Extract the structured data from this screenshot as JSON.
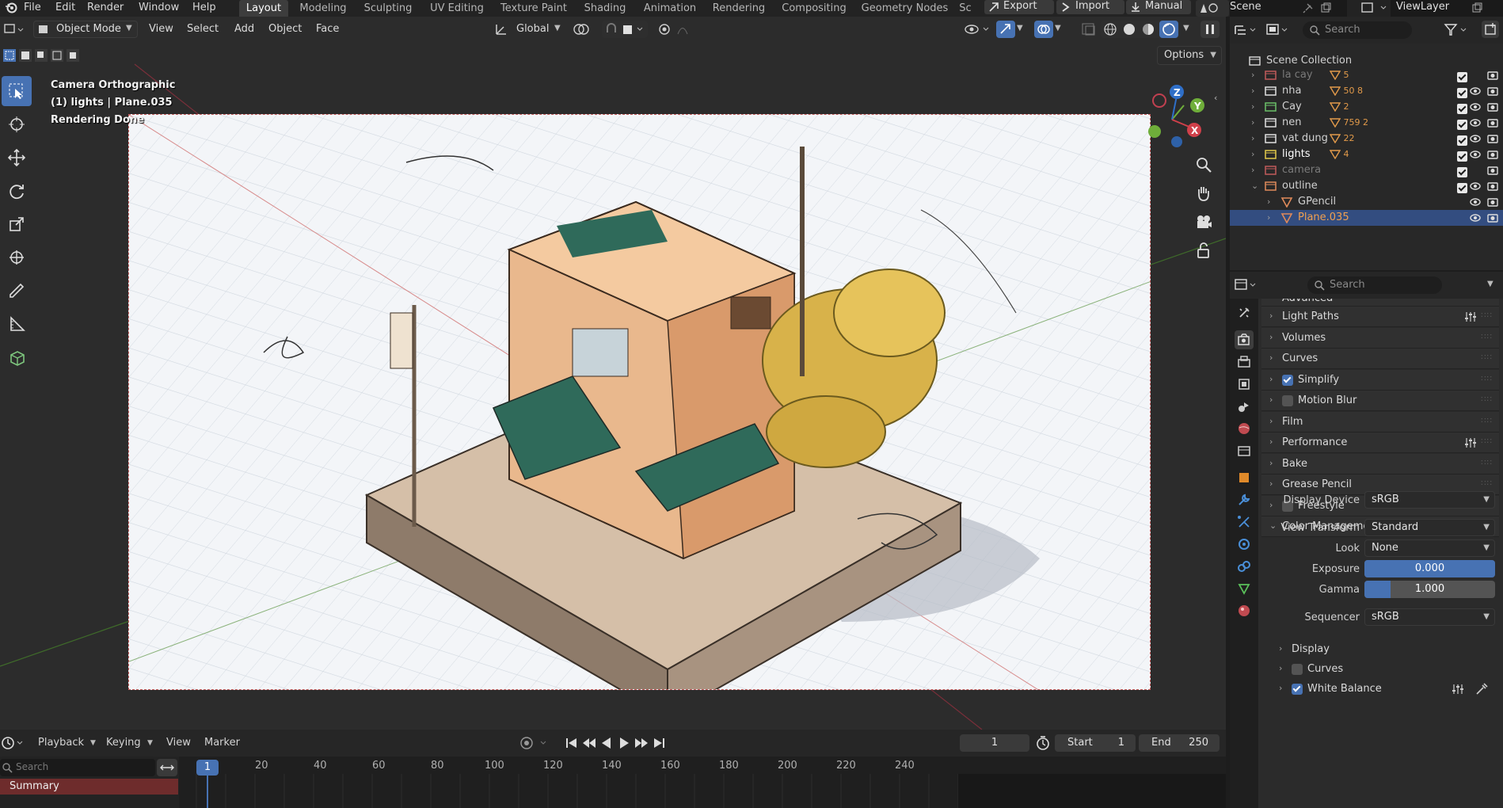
{
  "menu": {
    "items": [
      "File",
      "Edit",
      "Render",
      "Window",
      "Help"
    ],
    "workspaces": [
      "Layout",
      "Modeling",
      "Sculpting",
      "UV Editing",
      "Texture Paint",
      "Shading",
      "Animation",
      "Rendering",
      "Compositing",
      "Geometry Nodes",
      "Sc"
    ],
    "active_workspace": "Layout",
    "export_label": "Export",
    "import_label": "Import",
    "manual_label": "Manual",
    "scene_label": "Scene",
    "viewlayer_label": "ViewLayer"
  },
  "viewport": {
    "mode": "Object Mode",
    "menus": [
      "View",
      "Select",
      "Add",
      "Object",
      "Face"
    ],
    "transform_orientation": "Global",
    "options_label": "Options",
    "overlay_lines": [
      "Camera Orthographic",
      "(1) lights | Plane.035",
      "Rendering Done"
    ],
    "axis_labels": {
      "z": "Z",
      "y": "Y",
      "x": "X"
    }
  },
  "timeline": {
    "menus": [
      "Playback",
      "Keying",
      "View",
      "Marker"
    ],
    "current_frame": "1",
    "start_label": "Start",
    "start_value": "1",
    "end_label": "End",
    "end_value": "250",
    "search_placeholder": "Search",
    "summary_label": "Summary",
    "ruler_ticks": [
      "1",
      "20",
      "40",
      "60",
      "80",
      "100",
      "120",
      "140",
      "160",
      "180",
      "200",
      "220",
      "240"
    ]
  },
  "outliner": {
    "search_placeholder": "Search",
    "root": "Scene Collection",
    "rows": [
      {
        "name": "la cay",
        "badge": "5",
        "color": "#c05a5a",
        "dim": true
      },
      {
        "name": "nha",
        "badge": "50  8",
        "color": "#e0e0e0",
        "dim": false
      },
      {
        "name": "Cay",
        "badge": "2",
        "color": "#6abf69",
        "dim": false
      },
      {
        "name": "nen",
        "badge": "759  2",
        "color": "#e0e0e0",
        "dim": false
      },
      {
        "name": "vat dung",
        "badge": "22",
        "color": "#e0e0e0",
        "dim": false
      },
      {
        "name": "lights",
        "badge": "4",
        "color": "#e3c94a",
        "dim": false
      },
      {
        "name": "camera",
        "badge": "",
        "color": "#c05a5a",
        "dim": true
      },
      {
        "name": "outline",
        "badge": "",
        "color": "#e08a5a",
        "dim": false
      },
      {
        "name": "GPencil",
        "badge": "",
        "color": "#e08a5a",
        "dim": false
      },
      {
        "name": "Plane.035",
        "badge": "",
        "color": "#e08a5a",
        "dim": false
      }
    ]
  },
  "properties": {
    "search_placeholder": "Search",
    "top_panel": "Advanced",
    "panels": [
      {
        "label": "Light Paths",
        "checkbox": null
      },
      {
        "label": "Volumes",
        "checkbox": null
      },
      {
        "label": "Curves",
        "checkbox": null
      },
      {
        "label": "Simplify",
        "checkbox": true
      },
      {
        "label": "Motion Blur",
        "checkbox": false
      },
      {
        "label": "Film",
        "checkbox": null
      },
      {
        "label": "Performance",
        "checkbox": null
      },
      {
        "label": "Bake",
        "checkbox": null
      },
      {
        "label": "Grease Pencil",
        "checkbox": null
      },
      {
        "label": "Freestyle",
        "checkbox": false
      },
      {
        "label": "Color Management",
        "checkbox": null
      }
    ],
    "color_management": {
      "display_device_label": "Display Device",
      "display_device": "sRGB",
      "view_transform_label": "View Transform",
      "view_transform": "Standard",
      "look_label": "Look",
      "look": "None",
      "exposure_label": "Exposure",
      "exposure": "0.000",
      "exposure_fill": 1.0,
      "gamma_label": "Gamma",
      "gamma": "1.000",
      "gamma_fill": 0.2,
      "sequencer_label": "Sequencer",
      "sequencer": "sRGB"
    },
    "subpanels": [
      {
        "label": "Display",
        "checkbox": null
      },
      {
        "label": "Curves",
        "checkbox": false
      },
      {
        "label": "White Balance",
        "checkbox": true
      }
    ]
  },
  "colors": {
    "accent": "#4772b3",
    "selected_row": "#334d80",
    "header_bg": "#232323"
  }
}
